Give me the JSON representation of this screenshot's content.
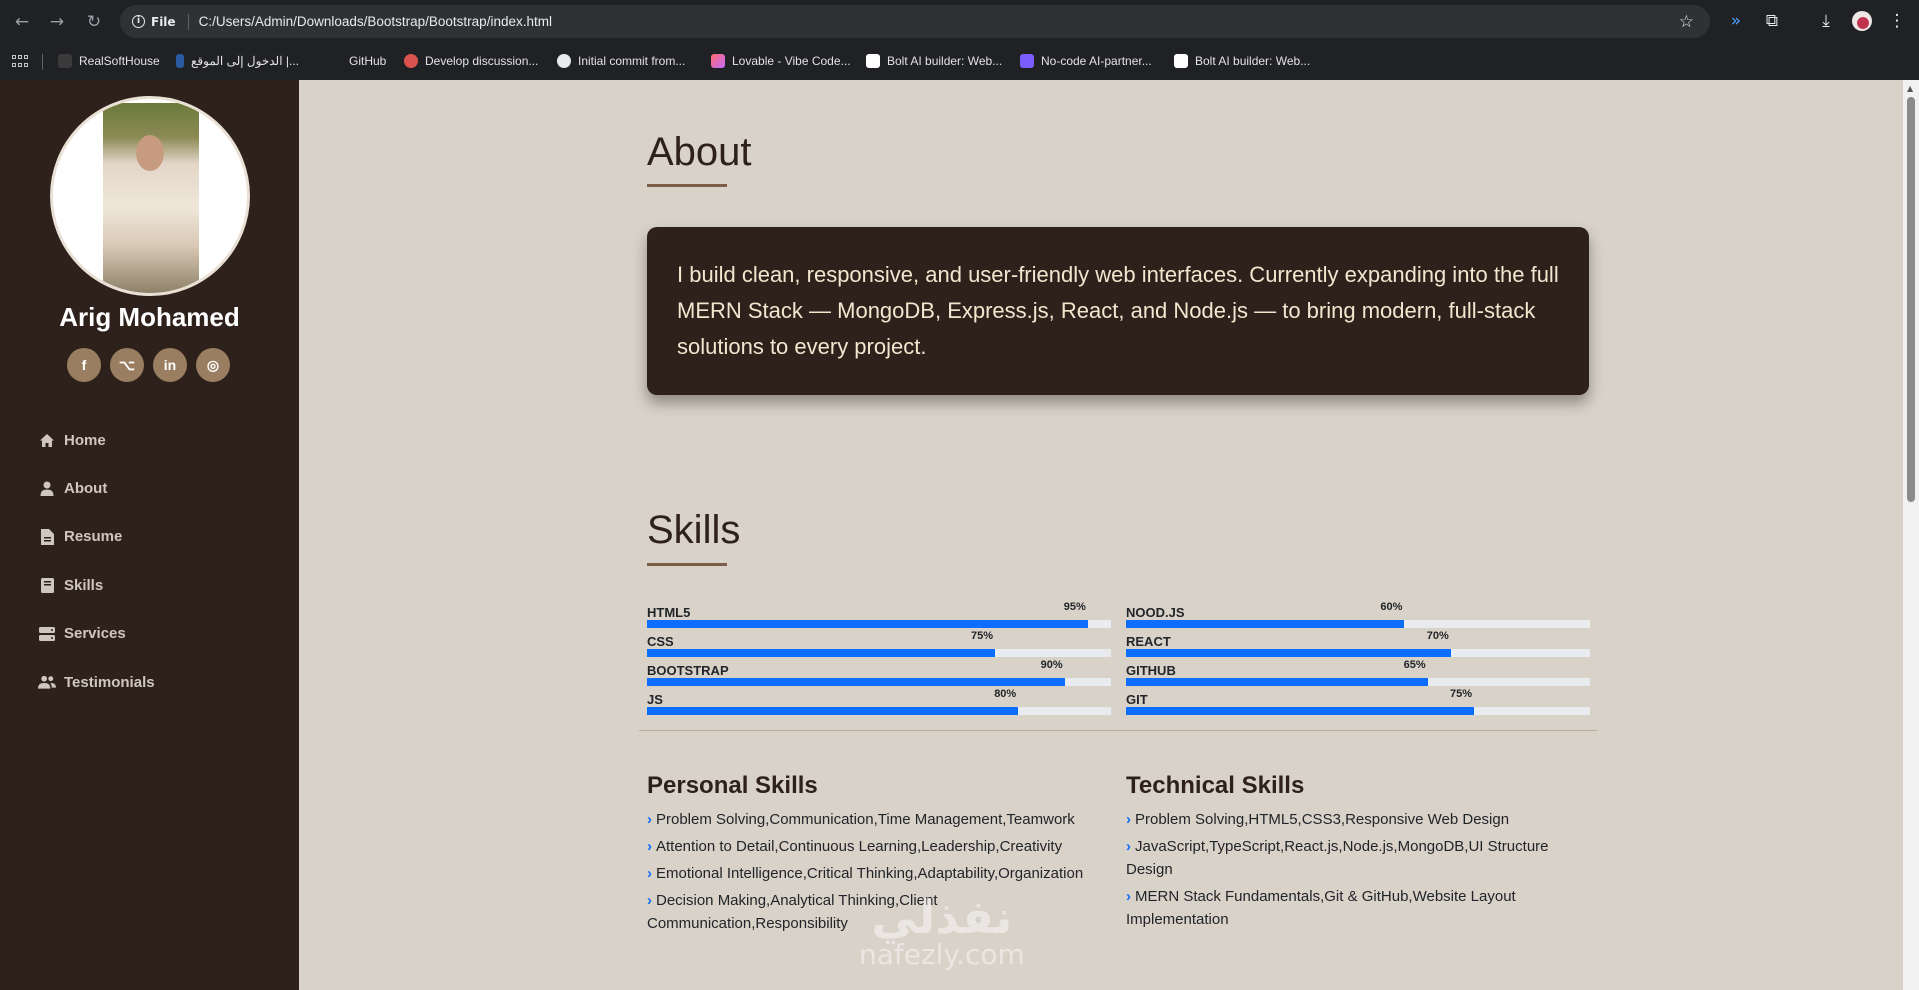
{
  "browser": {
    "url": "C:/Users/Admin/Downloads/Bootstrap/Bootstrap/index.html",
    "site_info_label": "File",
    "bookmarks": [
      {
        "label": "RealSoftHouse"
      },
      {
        "label": "الدخول إلى الموقع |..."
      },
      {
        "label": "GitHub"
      },
      {
        "label": "Develop discussion..."
      },
      {
        "label": "Initial commit from..."
      },
      {
        "label": "Lovable - Vibe Code..."
      },
      {
        "label": "Bolt AI builder: Web..."
      },
      {
        "label": "No-code AI-partner..."
      },
      {
        "label": "Bolt AI builder: Web..."
      }
    ]
  },
  "sidebar": {
    "name": "Arig Mohamed",
    "socials": [
      {
        "icon": "facebook-icon",
        "glyph": "f"
      },
      {
        "icon": "github-icon",
        "glyph": "⌥"
      },
      {
        "icon": "linkedin-icon",
        "glyph": "in"
      },
      {
        "icon": "instagram-icon",
        "glyph": "◎"
      }
    ],
    "menu": [
      {
        "label": "Home",
        "icon": "home-icon"
      },
      {
        "label": "About",
        "icon": "user-icon"
      },
      {
        "label": "Resume",
        "icon": "file-icon"
      },
      {
        "label": "Skills",
        "icon": "book-icon"
      },
      {
        "label": "Services",
        "icon": "server-icon"
      },
      {
        "label": "Testimonials",
        "icon": "users-icon"
      }
    ]
  },
  "about": {
    "title": "About",
    "text": "I build clean, responsive, and user-friendly web interfaces. Currently expanding into the full MERN Stack — MongoDB, Express.js, React, and Node.js — to bring modern, full-stack solutions to every project."
  },
  "skills": {
    "title": "Skills",
    "left": [
      {
        "name": "HTML5",
        "percent": 95,
        "label": "95%"
      },
      {
        "name": "CSS",
        "percent": 75,
        "label": "75%"
      },
      {
        "name": "BOOTSTRAP",
        "percent": 90,
        "label": "90%"
      },
      {
        "name": "JS",
        "percent": 80,
        "label": "80%"
      }
    ],
    "right": [
      {
        "name": "NOOD.JS",
        "percent": 60,
        "label": "60%"
      },
      {
        "name": "REACT",
        "percent": 70,
        "label": "70%"
      },
      {
        "name": "GITHUB",
        "percent": 65,
        "label": "65%"
      },
      {
        "name": "GIT",
        "percent": 75,
        "label": "75%"
      }
    ],
    "bar_color": "#0d6efd"
  },
  "personal_skills": {
    "title": "Personal Skills",
    "items": [
      "Problem Solving,Communication,Time Management,Teamwork",
      "Attention to Detail,Continuous Learning,Leadership,Creativity",
      "Emotional Intelligence,Critical Thinking,Adaptability,Organization",
      "Decision Making,Analytical Thinking,Client Communication,Responsibility"
    ]
  },
  "technical_skills": {
    "title": "Technical Skills",
    "items": [
      "Problem Solving,HTML5,CSS3,Responsive Web Design",
      "JavaScript,TypeScript,React.js,Node.js,MongoDB,UI Structure Design",
      "MERN Stack Fundamentals,Git & GitHub,Website Layout Implementation"
    ]
  },
  "watermark": {
    "arabic": "نفذلي",
    "latin": "nafezly.com"
  },
  "colors": {
    "sidebar_bg": "#2e211b",
    "page_bg": "#d9d2c9",
    "accent": "#9a7e61",
    "card_text": "#f2e6cf"
  }
}
